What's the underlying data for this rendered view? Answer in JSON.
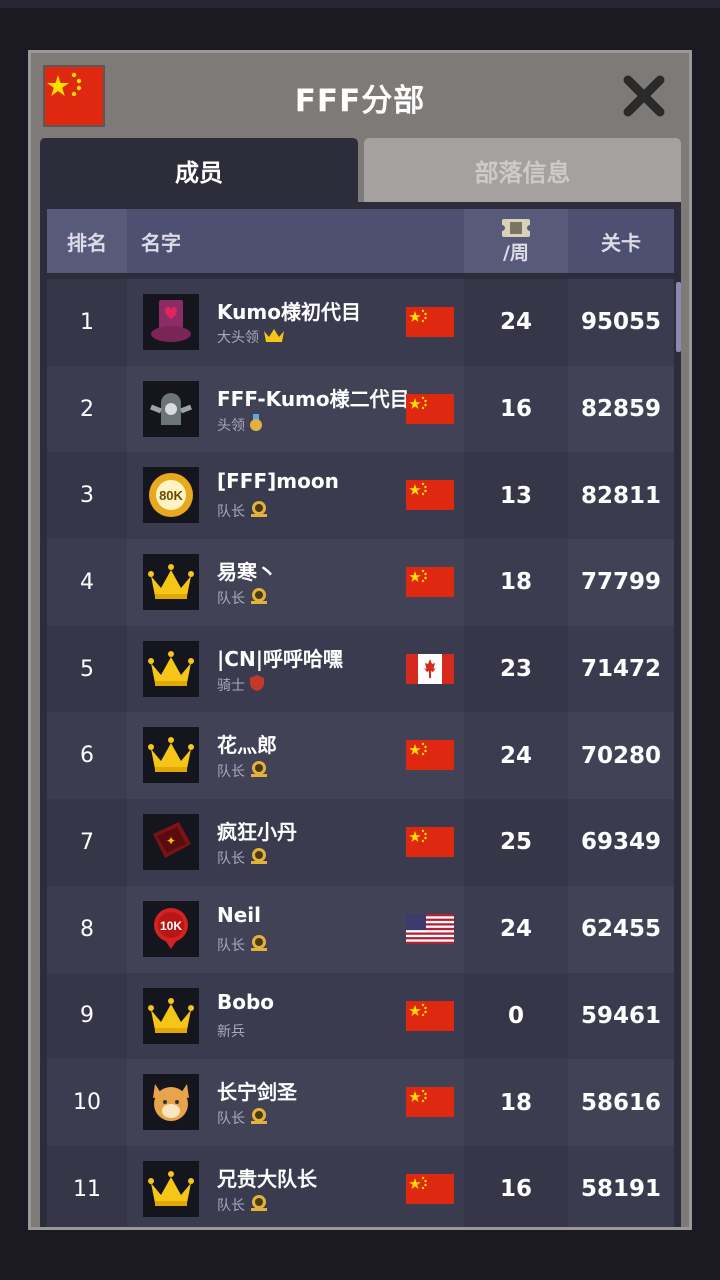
{
  "header": {
    "title": "FFF分部",
    "flag_icon": "china-flag-icon",
    "close_icon": "close-icon"
  },
  "tabs": [
    {
      "label": "成员",
      "active": true
    },
    {
      "label": "部落信息",
      "active": false
    }
  ],
  "table": {
    "columns": {
      "rank": "排名",
      "name": "名字",
      "week": "/周",
      "stage": "关卡"
    },
    "week_icon": "ticket-icon",
    "rows": [
      {
        "rank": "1",
        "name": "Kumo様初代目",
        "role": "大头领",
        "role_icon": "crown-icon",
        "avatar": "heart-top-hat-icon",
        "flag": "china",
        "week": "24",
        "stage": "95055"
      },
      {
        "rank": "2",
        "name": "FFF-Kumo様二代目",
        "role": "头领",
        "role_icon": "medal-icon",
        "avatar": "tombstone-skull-icon",
        "flag": "china",
        "week": "16",
        "stage": "82859"
      },
      {
        "rank": "3",
        "name": "[FFF]moon",
        "role": "队长",
        "role_icon": "captain-badge-icon",
        "avatar": "80k-medal-icon",
        "flag": "china",
        "week": "13",
        "stage": "82811"
      },
      {
        "rank": "4",
        "name": "易寒丶",
        "role": "队长",
        "role_icon": "captain-badge-icon",
        "avatar": "crown-avatar-icon",
        "flag": "china",
        "week": "18",
        "stage": "77799"
      },
      {
        "rank": "5",
        "name": "|CN|呼呼哈嘿",
        "role": "骑士",
        "role_icon": "shield-icon",
        "avatar": "crown-avatar-icon",
        "flag": "canada",
        "week": "23",
        "stage": "71472"
      },
      {
        "rank": "6",
        "name": "花灬郎",
        "role": "队长",
        "role_icon": "captain-badge-icon",
        "avatar": "crown-avatar-icon",
        "flag": "china",
        "week": "24",
        "stage": "70280"
      },
      {
        "rank": "7",
        "name": "疯狂小丹",
        "role": "队长",
        "role_icon": "captain-badge-icon",
        "avatar": "spell-book-icon",
        "flag": "china",
        "week": "25",
        "stage": "69349"
      },
      {
        "rank": "8",
        "name": "Neil",
        "role": "队长",
        "role_icon": "captain-badge-icon",
        "avatar": "10k-pin-icon",
        "flag": "usa",
        "week": "24",
        "stage": "62455"
      },
      {
        "rank": "9",
        "name": "Bobo",
        "role": "新兵",
        "role_icon": "",
        "avatar": "crown-avatar-icon",
        "flag": "china",
        "week": "0",
        "stage": "59461"
      },
      {
        "rank": "10",
        "name": "长宁剑圣",
        "role": "队长",
        "role_icon": "captain-badge-icon",
        "avatar": "shiba-dog-icon",
        "flag": "china",
        "week": "18",
        "stage": "58616"
      },
      {
        "rank": "11",
        "name": "兄贵大队长",
        "role": "队长",
        "role_icon": "captain-badge-icon",
        "avatar": "crown-avatar-icon",
        "flag": "china",
        "week": "16",
        "stage": "58191"
      }
    ]
  },
  "colors": {
    "panel": "#7d7a78",
    "table_bg": "#2d2c3b",
    "header_row": "#585a7a",
    "china_red": "#de2910",
    "star_yellow": "#ffde00"
  }
}
